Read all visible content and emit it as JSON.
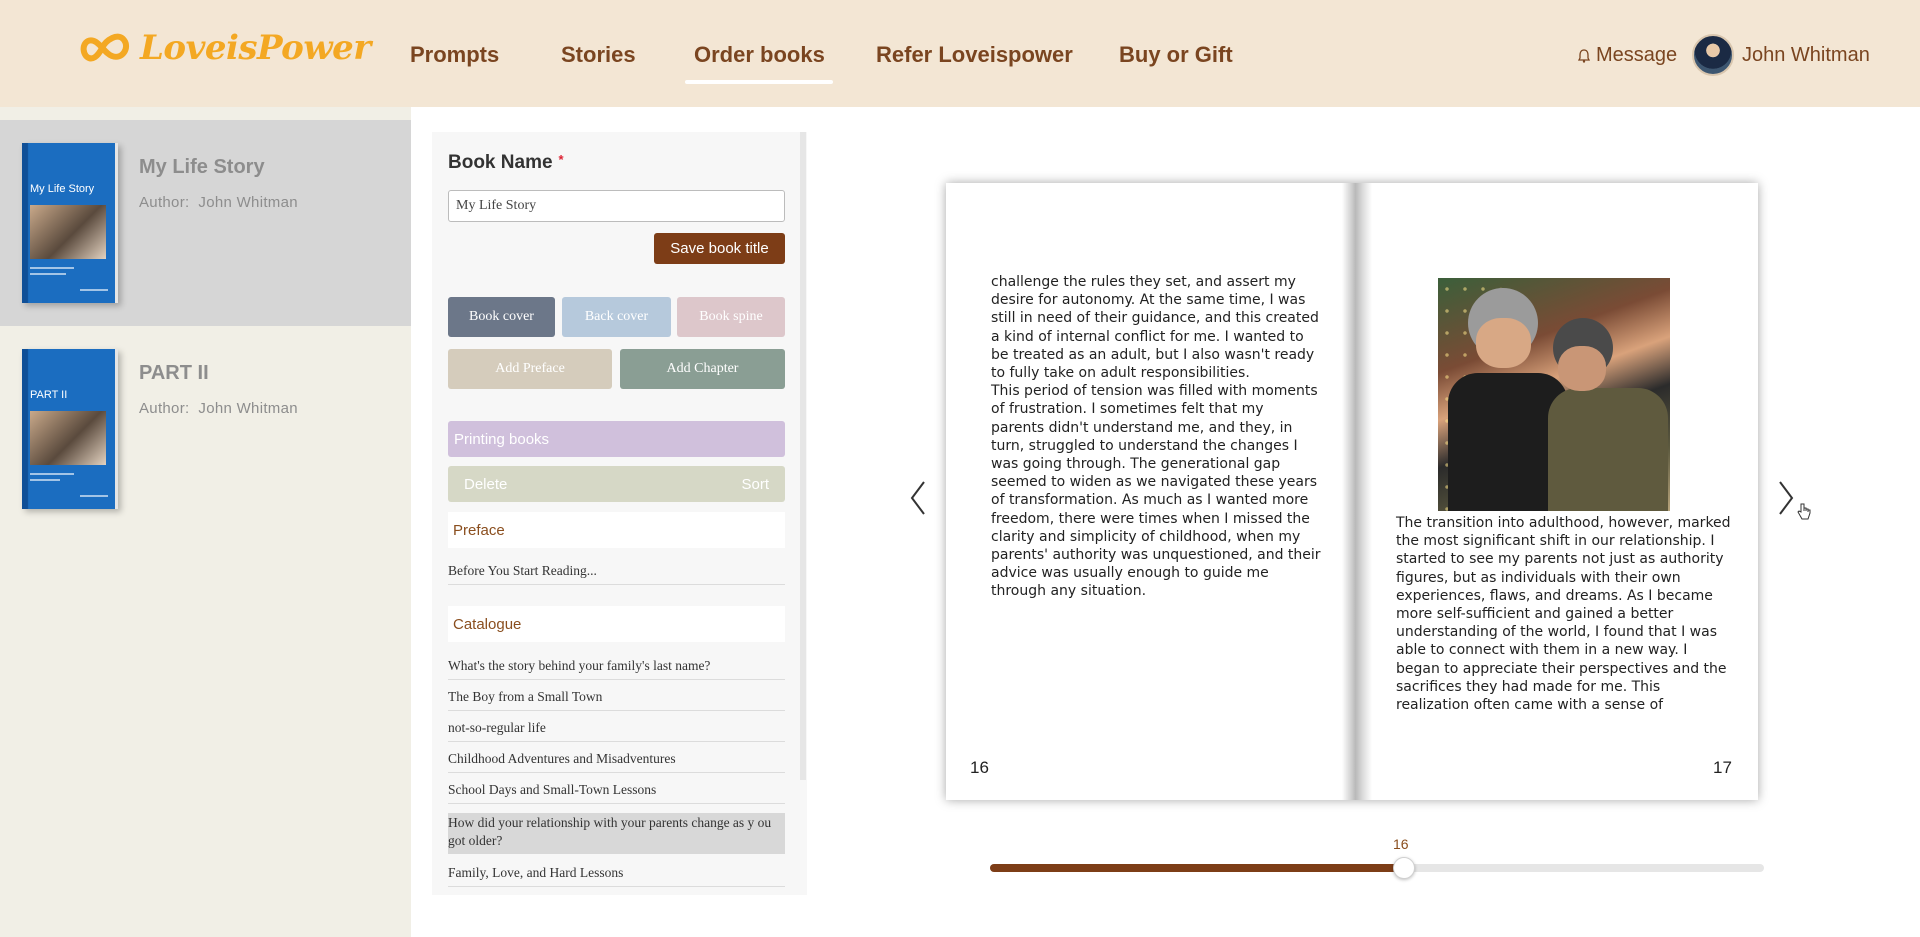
{
  "header": {
    "logo_text": "LoveisPower",
    "nav": [
      {
        "label": "Prompts"
      },
      {
        "label": "Stories"
      },
      {
        "label": "Order books"
      },
      {
        "label": "Refer Loveispower"
      },
      {
        "label": "Buy or Gift"
      }
    ],
    "active_nav": "Order books",
    "message_label": "Message",
    "user_name": "John Whitman"
  },
  "sidebar": {
    "books": [
      {
        "title": "My Life Story",
        "author_label": "Author:",
        "author": "John Whitman",
        "cover_title": "My Life Story",
        "selected": true
      },
      {
        "title": "PART II",
        "author_label": "Author:",
        "author": "John Whitman",
        "cover_title": "PART II",
        "selected": false
      }
    ]
  },
  "editor": {
    "book_name_label": "Book Name",
    "required_mark": "*",
    "book_name_value": "My Life Story",
    "save_button": "Save book title",
    "tabs": [
      "Book cover",
      "Back cover",
      "Book spine"
    ],
    "add_preface": "Add Preface",
    "add_chapter": "Add Chapter",
    "printing_books": "Printing books",
    "delete_label": "Delete",
    "sort_label": "Sort",
    "preface_heading": "Preface",
    "preface_items": [
      "Before You Start Reading..."
    ],
    "catalogue_heading": "Catalogue",
    "catalogue_items": [
      "What's the story behind your family's last name?",
      "The Boy from a Small Town",
      "not-so-regular life",
      "Childhood Adventures and Misadventures",
      "School Days and Small-Town Lessons",
      "How did your relationship with your parents change as y ou got older?",
      "Family, Love, and Hard Lessons"
    ],
    "selected_catalogue_index": 5
  },
  "preview": {
    "left_page_text": "challenge the rules they set, and assert my desire for autonomy. At the same time, I was still in need of their guidance, and this created a kind of internal conflict for me. I wanted to be treated as an adult, but I also wasn't ready to fully take on adult responsibilities.\nThis period of tension was filled with moments of frustration. I sometimes felt that my parents didn't understand me, and they, in turn, struggled to understand the changes I was going through. The generational gap seemed to widen as we navigated these years of transformation. As much as I wanted more freedom, there were times when I missed the clarity and simplicity of childhood, when my parents' authority was unquestioned, and their advice was usually enough to guide me through any situation.",
    "right_page_text": "The transition into adulthood, however, marked the most significant shift in our relationship. I started to see my parents not just as authority figures, but as individuals with their own experiences, flaws, and dreams. As I became more self-sufficient and gained a better understanding of the world, I found that I was able to connect with them in a new way. I began to appreciate their perspectives and the sacrifices they had made for me. This realization often came with a sense of",
    "left_page_number": "16",
    "right_page_number": "17"
  },
  "slider": {
    "value_label": "16",
    "fraction": 0.535
  },
  "colors": {
    "header_bg": "#f3e6d4",
    "brand_brown": "#7d3d17",
    "logo_orange": "#f3a823"
  }
}
